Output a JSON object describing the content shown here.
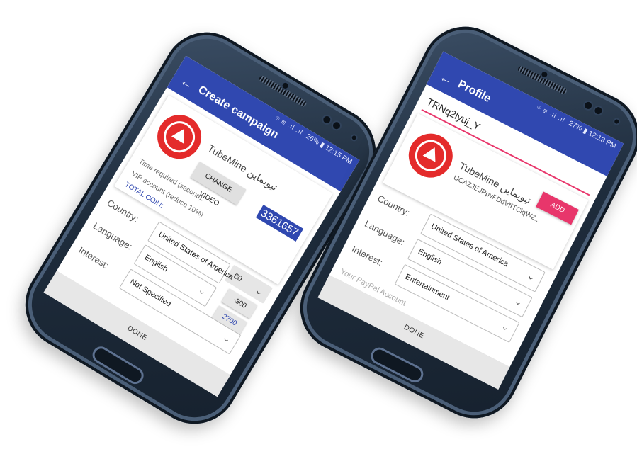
{
  "left": {
    "status": {
      "icons": "⌾ ⊞ .ıl .ıl",
      "battery": "26%",
      "time": "12:15 PM"
    },
    "title": "Create campaign",
    "channel": {
      "name": "TubeMine تیوبماین"
    },
    "coin_count": "3361657",
    "change_video_label": "CHANGE VIDEO",
    "time_required_label": "Time required (second):",
    "time_value": "60",
    "vip_label": "VIP account (reduce 10%)",
    "vip_value": "-300",
    "total_coin_label": "TOTAL COIN:",
    "total_value": "2700",
    "country_label": "Country:",
    "country_value": "United States of America",
    "language_label": "Language:",
    "language_value": "English",
    "interest_label": "Interest:",
    "interest_value": "Not Specified",
    "done_label": "DONE"
  },
  "right": {
    "status": {
      "icons": "⌾ ⊞ .ıl .ıl",
      "battery": "27%",
      "time": "12:13 PM"
    },
    "title": "Profile",
    "input_value": "TRNq2lyuj_Y",
    "channel": {
      "name": "TubeMine تیوبماین",
      "id": "UCAZJEJPpvFDdVfITCiqW2..."
    },
    "add_label": "ADD",
    "country_label": "Country:",
    "country_value": "United States of America",
    "language_label": "Language:",
    "language_value": "English",
    "interest_label": "Interest:",
    "interest_value": "Entertainment",
    "paypal_placeholder": "Your PayPal Account",
    "done_label": "DONE"
  },
  "colors": {
    "appbar": "#3048b0",
    "accent": "#e8366b",
    "logo": "#e42b2b",
    "total_coin": "#3048b0"
  }
}
